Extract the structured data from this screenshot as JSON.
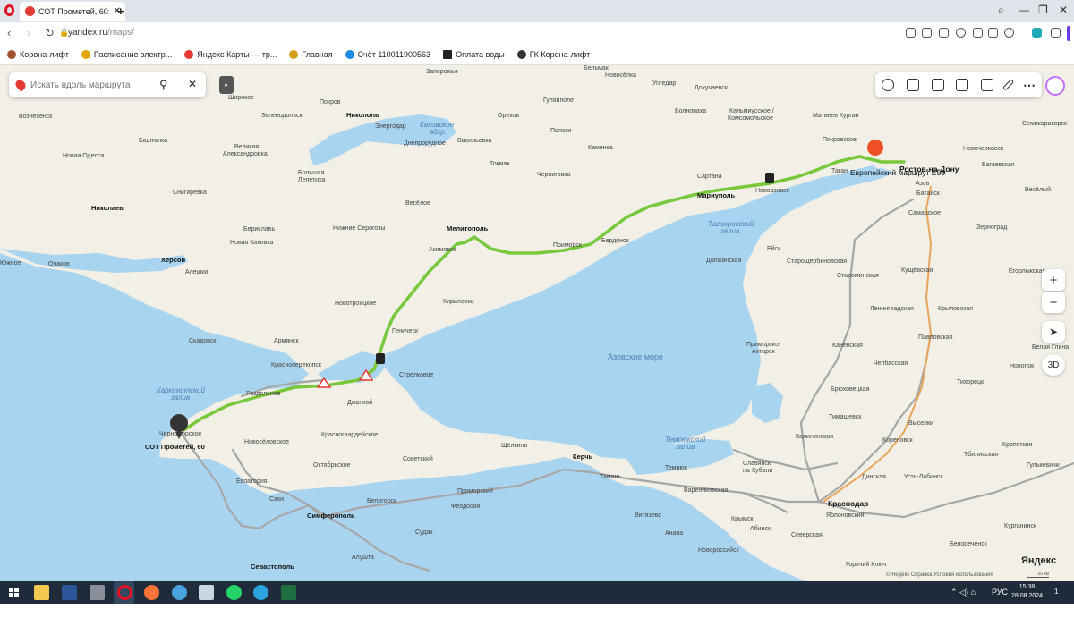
{
  "browser": {
    "tab_title": "СОТ Прометей, 60: как до",
    "tab_close": "✕",
    "new_tab": "+",
    "url_host": "yandex.ru",
    "url_path": "/maps/",
    "window_controls": [
      "⌕",
      "—",
      "❐",
      "✕"
    ],
    "nav": {
      "back": "‹",
      "forward": "›",
      "reload": "↻"
    }
  },
  "bookmarks": [
    {
      "label": "Корона-лифт",
      "color": "#a0522d"
    },
    {
      "label": "Расписание электр...",
      "color": "#e0a800"
    },
    {
      "label": "Яндекс Карты — тр...",
      "color": "#e53935"
    },
    {
      "label": "Главная",
      "color": "#d4a017"
    },
    {
      "label": "Счёт 110011900563",
      "color": "#1e88e5"
    },
    {
      "label": "Оплата воды",
      "color": "#222222"
    },
    {
      "label": "ГК Корона-лифт",
      "color": "#333333"
    }
  ],
  "map": {
    "search_placeholder": "Искать вдоль маршрута",
    "search_icon": "search-icon",
    "collapse": "▸",
    "zoom_in": "+",
    "zoom_out": "−",
    "view_3d": "3D",
    "locate": "➤",
    "logo": "Яндекс",
    "copyright": "© Яндекс  Справка  Условия использования",
    "scale": "30 км",
    "route_label": "Европейский маршрут Е58",
    "destination": "СОТ Прометей, 60",
    "colors": {
      "water": "#a8d4f0",
      "land": "#f1efe6",
      "route": "#78c83c",
      "road": "#9e9e9e"
    },
    "labels": {
      "zaporozhye": "Запорожье",
      "belmak": "Бельмак",
      "novoselka": "Новосёлка",
      "ugledar": "Угледар",
      "dokuchaevsk": "Докучаевск",
      "shirokoe": "Широкое",
      "pokrov": "Покров",
      "nikopol": "Никополь",
      "gulyaypole": "Гуляйполе",
      "volnovakha": "Волноваха",
      "kalmiusskoe": "Кальмиусское /",
      "komsomolskoe": "Комсомольское",
      "matveev": "Матвеев Курган",
      "semikar": "Семикаракорск",
      "voznesensk": "Вознесенск",
      "zelenodolsk": "Зеленодольск",
      "energodar": "Энергодар",
      "kakhovka_res": "Каховское",
      "kakhovka_res2": "вдхр.",
      "orekhov": "Орехов",
      "pologi": "Пологи",
      "dneprorudnoe": "Днепрорудное",
      "vasilevka": "Васильевка",
      "kamenka": "Каменка",
      "pokrovskoe": "Покровское",
      "bashtanka": "Баштанка",
      "velikaya": "Великая",
      "velikaya2": "Александровка",
      "tokmak": "Токмак",
      "novaya_odessa": "Новая Одесса",
      "snigirevka": "Снигирёвка",
      "bolshaya": "Большая",
      "bolshaya2": "Лепетиха",
      "chernigovka": "Черниговка",
      "sartana": "Сартана",
      "novoazovsk": "Новоазовск",
      "mariupol": "Мариуполь",
      "novocherkassk": "Новочеркасск",
      "bagaevskaya": "Багаевская",
      "nikolaev": "Николаев",
      "veselyy": "Весёлый",
      "rostov": "Ростов-на-Дону",
      "taganrog": "Таган",
      "bataisk": "Батайск",
      "berislav": "Бериславь",
      "nizhnie": "Нижние Серогозы",
      "veseloe": "Весёлое",
      "melitopol": "Мелитополь",
      "berdyansk": "Бердянск",
      "primorsk": "Приморск",
      "samarskoe": "Самарское",
      "zernograd": "Зерноград",
      "novaya_kakhovka": "Новая Каховка",
      "kherson": "Херсон",
      "akimovka": "Акимовка",
      "taganrog_bay": "Таганрогский",
      "taganrog_bay2": "залив",
      "eysk": "Ейск",
      "azov": "Азов",
      "yuzhnoe": "Южное",
      "ochakov": "Очаков",
      "aleshki": "Алешки",
      "dolzhanskaya": "Должанская",
      "starosh": "Старощербиновская",
      "yegorlyk": "Егорлыкская",
      "staromin": "Староминская",
      "kushchev": "Кущёвская",
      "novotroitskoe": "Новотроицкое",
      "kirillovka": "Кириловка",
      "leningrad": "Ленинградская",
      "krylovsk": "Крыловская",
      "genichesk": "Геническ",
      "armyansk": "Армянск",
      "skadovsk": "Скадовск",
      "kanevskaya": "Каневская",
      "pavlovskaya": "Павловская",
      "belaya_glina": "Белая Глина",
      "krasnoperekopsk": "Красноперекопск",
      "strelkovoe": "Стрелковое",
      "azov_sea": "Азовское море",
      "primorsko": "Приморско-",
      "akhtarsk": "Ахтарск",
      "chelbasskaya": "Челбасская",
      "novopok": "Новопок",
      "karkinit": "Каркинитский",
      "karkinit2": "залив",
      "razdolnoe": "Раздольное",
      "dzhankoy": "Джанкой",
      "bryukhov": "Брюховецкая",
      "tikhoretsk": "Тихорецк",
      "timashevsk": "Тимашевск",
      "vyselki": "Выселки",
      "chernomorskoe": "Черноморское",
      "novoselovskoe": "Новосёловское",
      "krasnogvard": "Красногвардейское",
      "kalininskaya": "Калининская",
      "korenovsk": "Кореновск",
      "kropotkin": "Кропоткин",
      "sovetskiy": "Советский",
      "shchelkino": "Щёлкино",
      "oktyabrskoe": "Октябрьское",
      "temryuk_bay": "Темрюкский",
      "temryuk_bay2": "залив",
      "tbilisskaya": "Тбилисская",
      "gulkevichi": "Гулькевичи",
      "kerch": "Керчь",
      "temryuk": "Темрюк",
      "slavyansk": "Славянск-",
      "slavyansk2": "на-Кубани",
      "dinskaya": "Динская",
      "evpatoria": "Евпатория",
      "taman": "Тамань",
      "ust_labinsk": "Усть-Лабинск",
      "primorskiy": "Приморский",
      "varenikovskaya": "Варениковская",
      "saki": "Саки",
      "belogorsk": "Белогорск",
      "feodosia": "Феодосия",
      "krasnodar": "Краснодар",
      "simferopol": "Симферополь",
      "vityazevo": "Витязево",
      "krymsk": "Крымск",
      "anapa": "Анапа",
      "sudak": "Судак",
      "abinsk": "Абинск",
      "severskaya": "Северская",
      "kurganinsk": "Курганинск",
      "yablonovskiy": "Яблоновский",
      "alushta": "Алушта",
      "novoross": "Новороссийск",
      "belorechensk": "Белореченск",
      "sevastopol": "Севастополь",
      "goryachiy": "Горячий Ключ"
    }
  },
  "taskbar": {
    "time": "15:38",
    "date": "28.08.2024",
    "lang": "РУС",
    "tray": "⌃ ◁) ⌂",
    "notif": "1"
  }
}
